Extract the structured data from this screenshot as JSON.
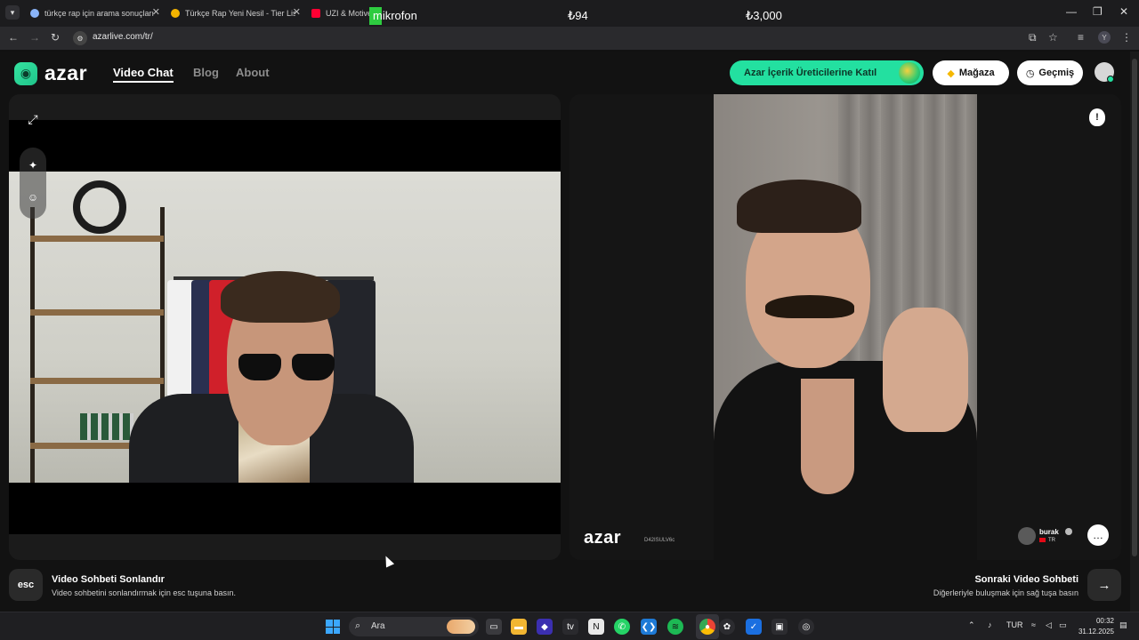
{
  "browser": {
    "tabs": [
      {
        "title": "türkçe rap için arama sonuçları",
        "favicon_color": "#8ab4f8"
      },
      {
        "title": "Türkçe Rap Yeni Nesil - Tier List",
        "favicon_color": "#f4b400"
      },
      {
        "title": "UZI & Motive",
        "favicon_color": "#ff0033"
      }
    ],
    "tab_close_glyph": "✕",
    "url": "azarlive.com/tr/",
    "overlay": {
      "mic_label": "mikrofon",
      "amount_1": "₺94",
      "amount_2": "₺3,000"
    },
    "profile_initial": "Y"
  },
  "site": {
    "logo_text": "azar",
    "nav": [
      {
        "label": "Video Chat",
        "active": true
      },
      {
        "label": "Blog",
        "active": false
      },
      {
        "label": "About",
        "active": false
      }
    ],
    "creator_button": "Azar İçerik Üreticilerine Katıl",
    "store_button": "Mağaza",
    "history_button": "Geçmiş"
  },
  "remote": {
    "watermark_logo": "azar",
    "watermark_id": "D42ISULV6c",
    "peer_name": "burak",
    "peer_country": "TR"
  },
  "footer": {
    "esc_key": "esc",
    "end_title": "Video Sohbeti Sonlandır",
    "end_sub": "Video sohbetini sonlandırmak için esc tuşuna basın.",
    "next_title": "Sonraki Video Sohbeti",
    "next_sub": "Diğerleriyle buluşmak için sağ tuşa basın"
  },
  "taskbar": {
    "search_placeholder": "Ara",
    "language": "TUR",
    "time": "00:32",
    "date": "31.12.2025"
  },
  "colors": {
    "accent": "#23e0a0",
    "page_bg": "#121212"
  }
}
